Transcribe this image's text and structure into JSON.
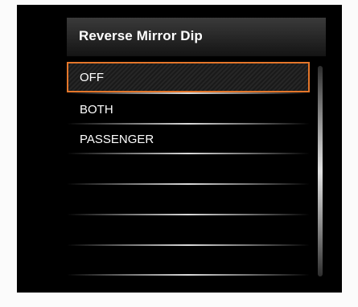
{
  "menu": {
    "title": "Reverse Mirror Dip",
    "items": [
      {
        "label": "OFF",
        "selected": true
      },
      {
        "label": "BOTH",
        "selected": false
      },
      {
        "label": "PASSENGER",
        "selected": false
      }
    ]
  },
  "colors": {
    "highlight_border": "#e4762a",
    "text": "#ffffff",
    "background": "#000000"
  }
}
